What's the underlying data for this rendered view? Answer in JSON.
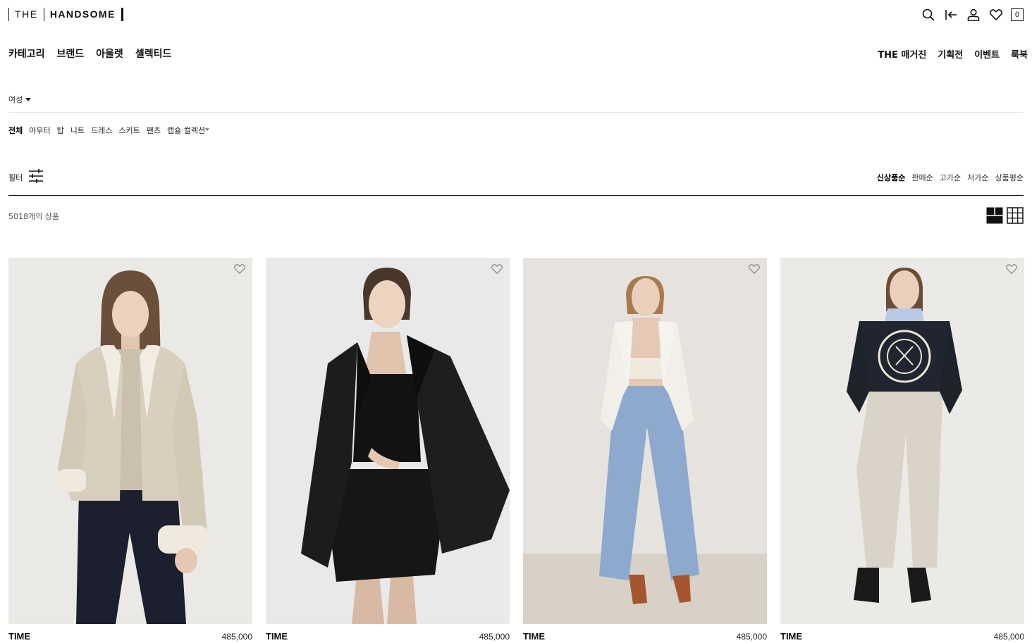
{
  "logo": {
    "the": "THE",
    "brand": "HANDSOME"
  },
  "cart": {
    "count": "0"
  },
  "gnb": {
    "left": [
      "카테고리",
      "브랜드",
      "아울렛",
      "셀렉티드"
    ],
    "right": [
      "THE 매거진",
      "기획전",
      "이벤트",
      "룩북"
    ]
  },
  "gender": {
    "label": "여성"
  },
  "categories": [
    "전체",
    "아우터",
    "탑",
    "니트",
    "드레스",
    "스커트",
    "팬츠",
    "캡슐 컬렉션*"
  ],
  "filter": {
    "label": "필터"
  },
  "sort": [
    "신상품순",
    "판매순",
    "고가순",
    "저가순",
    "상품평순"
  ],
  "count": {
    "text": "5018개의 상품"
  },
  "products": [
    {
      "brand": "TIME",
      "price": "485,000"
    },
    {
      "brand": "TIME",
      "price": "485,000"
    },
    {
      "brand": "TIME",
      "price": "485,000"
    },
    {
      "brand": "TIME",
      "price": "485,000"
    }
  ],
  "colors": {
    "text": "#111111",
    "divider": "#e6e6e6",
    "background": "#ffffff"
  },
  "icons": [
    "search-icon",
    "logout-icon",
    "user-icon",
    "heart-icon",
    "filter-icon",
    "grid-2-icon",
    "grid-3-icon"
  ]
}
